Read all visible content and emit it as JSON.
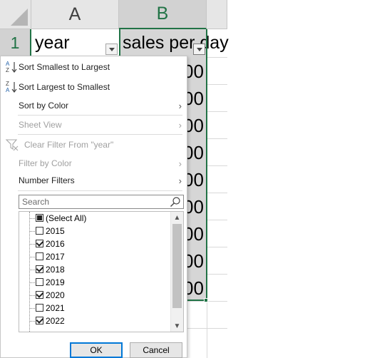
{
  "columns": {
    "a": "A",
    "b": "B"
  },
  "row_number": "1",
  "cells": {
    "a1": "year",
    "b1": "sales per day"
  },
  "b_values": [
    "00",
    "00",
    "00",
    "00",
    "00",
    "00",
    "00",
    "00",
    "00"
  ],
  "menu": {
    "sort_asc": "Sort Smallest to Largest",
    "sort_desc": "Sort Largest to Smallest",
    "sort_by_color": "Sort by Color",
    "sheet_view": "Sheet View",
    "clear_filter": "Clear Filter From \"year\"",
    "filter_by_color": "Filter by Color",
    "number_filters": "Number Filters"
  },
  "search": {
    "placeholder": "Search"
  },
  "list": [
    {
      "label": "(Select All)",
      "state": "partial"
    },
    {
      "label": "2015",
      "state": "unchecked"
    },
    {
      "label": "2016",
      "state": "checked"
    },
    {
      "label": "2017",
      "state": "unchecked"
    },
    {
      "label": "2018",
      "state": "checked"
    },
    {
      "label": "2019",
      "state": "unchecked"
    },
    {
      "label": "2020",
      "state": "checked"
    },
    {
      "label": "2021",
      "state": "unchecked"
    },
    {
      "label": "2022",
      "state": "checked"
    }
  ],
  "buttons": {
    "ok": "OK",
    "cancel": "Cancel"
  },
  "colors": {
    "excel_green": "#217346",
    "selected_fill": "#d6d6d6",
    "header_fill": "#e6e6e6"
  }
}
